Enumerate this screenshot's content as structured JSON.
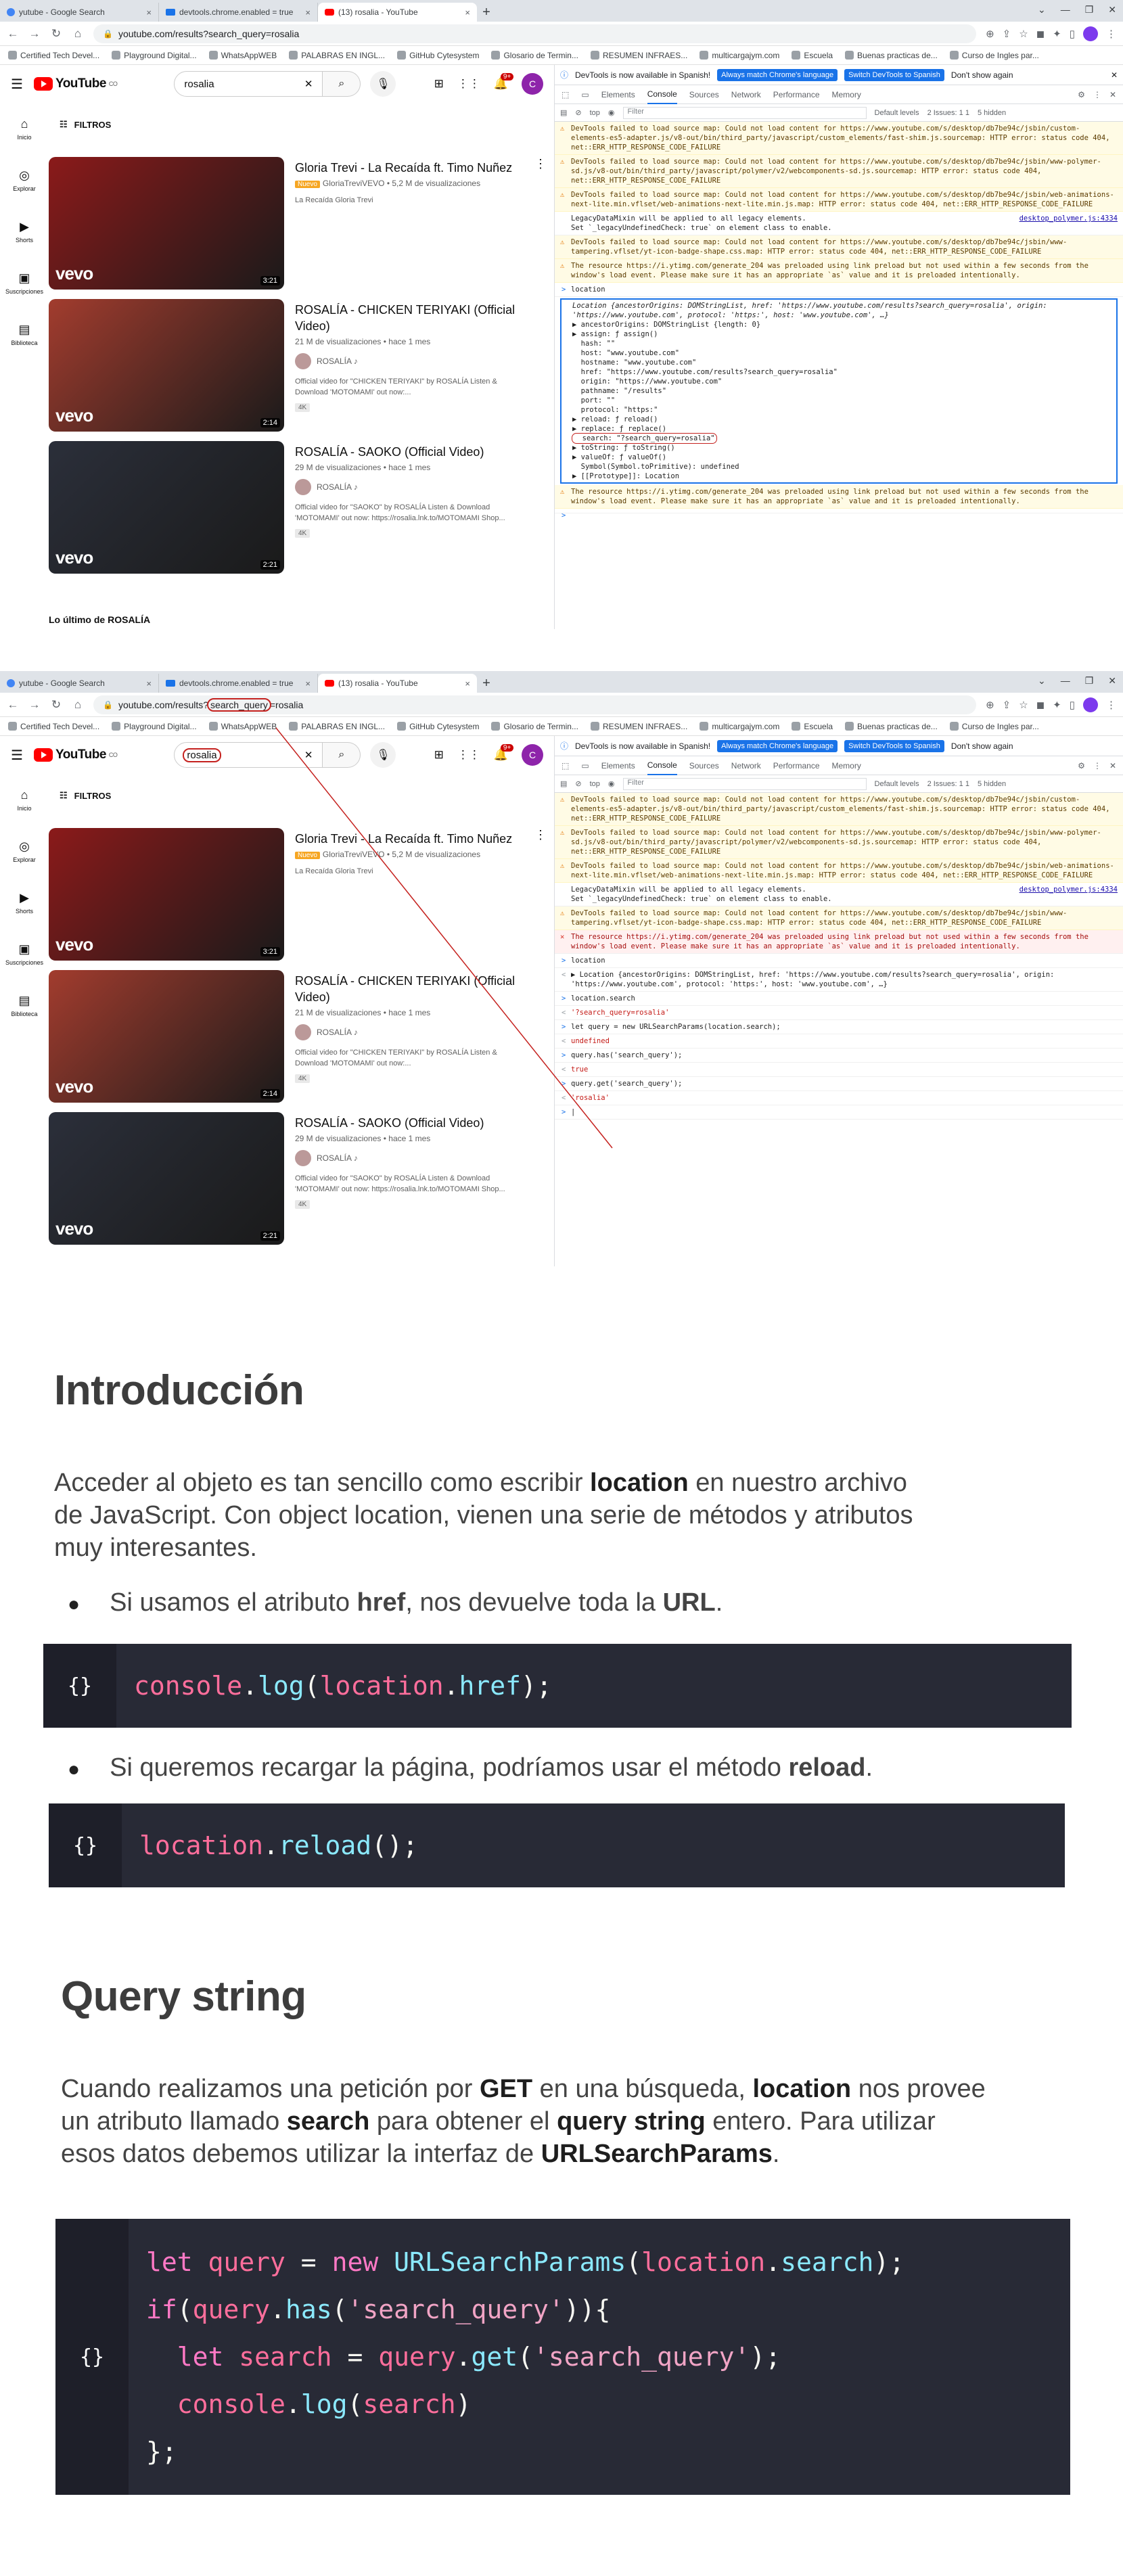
{
  "shot1": {
    "tabs": [
      {
        "label": "yutube - Google Search",
        "active": false
      },
      {
        "label": "devtools.chrome.enabled = true",
        "active": false
      },
      {
        "label": "(13) rosalia - YouTube",
        "active": true
      }
    ],
    "url_prefix": "youtube.com/results?",
    "url_query": "search_query",
    "url_suffix": "=rosalia"
  },
  "bookmarks": [
    "Certified Tech Devel...",
    "Playground Digital...",
    "WhatsAppWEB",
    "PALABRAS EN INGL...",
    "GitHub Cytesystem",
    "Glosario de Termin...",
    "RESUMEN INFRAES...",
    "multicargajym.com",
    "Escuela",
    "Buenas practicas de...",
    "Curso de Ingles par..."
  ],
  "youtube": {
    "logo_text": "YouTube",
    "logo_country": "CO",
    "search_value": "rosalia",
    "notif_count": "9+",
    "avatar_letter": "C",
    "filters_label": "FILTROS",
    "guide": [
      "Inicio",
      "Explorar",
      "Shorts",
      "Suscripciones",
      "Biblioteca"
    ],
    "videos": [
      {
        "title": "Gloria Trevi - La Recaída ft. Timo Nuñez",
        "badge": "Nuevo",
        "channel": "GloriaTreviVEVO",
        "meta": "5,2 M de visualizaciones",
        "desc": "La Recaída Gloria Trevi",
        "duration": "3:21",
        "color": "#8b1a1a"
      },
      {
        "title": "ROSALÍA - CHICKEN TERIYAKI (Official Video)",
        "meta": "21 M de visualizaciones • hace 1 mes",
        "channel": "ROSALÍA ♪",
        "desc": "Official video for \"CHICKEN TERIYAKI\" by ROSALÍA Listen & Download 'MOTOMAMI' out now:...",
        "tag": "4K",
        "duration": "2:14",
        "color": "#a23c2e"
      },
      {
        "title": "ROSALÍA - SAOKO (Official Video)",
        "meta": "29 M de visualizaciones • hace 1 mes",
        "channel": "ROSALÍA ♪",
        "desc": "Official video for \"SAOKO\" by ROSALÍA Listen & Download 'MOTOMAMI' out now: https://rosalia.lnk.to/MOTOMAMI Shop...",
        "tag": "4K",
        "duration": "2:21",
        "color": "#2b2f3a"
      }
    ],
    "last_section": "Lo último de ROSALÍA"
  },
  "devtools": {
    "infobar_text": "DevTools is now available in Spanish!",
    "btn_match": "Always match Chrome's language",
    "btn_switch": "Switch DevTools to Spanish",
    "btn_dont": "Don't show again",
    "tabs": [
      "Elements",
      "Console",
      "Sources",
      "Network",
      "Performance",
      "Memory"
    ],
    "issues": "2 Issues: 1 1",
    "hidden": "5 hidden",
    "context": "top",
    "filter_placeholder": "Filter",
    "levels": "Default levels",
    "warn1": "DevTools failed to load source map: Could not load content for https://www.youtube.com/s/desktop/db7be94c/jsbin/custom-elements-es5-adapter.js/v8-out/bin/third_party/javascript/custom_elements/fast-shim.js.sourcemap: HTTP error: status code 404, net::ERR_HTTP_RESPONSE_CODE_FAILURE",
    "warn2": "DevTools failed to load source map: Could not load content for https://www.youtube.com/s/desktop/db7be94c/jsbin/www-polymer-sd.js/v8-out/bin/third_party/javascript/polymer/v2/webcomponents-sd.js.sourcemap: HTTP error: status code 404, net::ERR_HTTP_RESPONSE_CODE_FAILURE",
    "warn3": "DevTools failed to load source map: Could not load content for https://www.youtube.com/s/desktop/db7be94c/jsbin/web-animations-next-lite.min.vflset/web-animations-next-lite.min.js.map: HTTP error: status code 404, net::ERR_HTTP_RESPONSE_CODE_FAILURE",
    "legacy": "LegacyDataMixin will be applied to all legacy elements.\nSet `_legacyUndefinedCheck: true` on element class to enable.",
    "legacy_src": "desktop_polymer.js:4334",
    "warn4": "DevTools failed to load source map: Could not load content for https://www.youtube.com/s/desktop/db7be94c/jsbin/www-tampering.vflset/yt-icon-badge-shape.css.map: HTTP error: status code 404, net::ERR_HTTP_RESPONSE_CODE_FAILURE",
    "preload": "The resource https://i.ytimg.com/generate_204 was preloaded using link preload but not used within a few seconds from the window's load event. Please make sure it has an appropriate `as` value and it is preloaded intentionally.",
    "preload_src": "results:1",
    "cmd_location": "location",
    "obj_header": "Location {ancestorOrigins: DOMStringList, href: 'https://www.youtube.com/results?search_query=rosalia', origin: 'https://www.youtube.com', protocol: 'https:', host: 'www.youtube.com', …}",
    "obj_lines": [
      "▶ ancestorOrigins: DOMStringList {length: 0}",
      "▶ assign: ƒ assign()",
      "  hash: \"\"",
      "  host: \"www.youtube.com\"",
      "  hostname: \"www.youtube.com\"",
      "  href: \"https://www.youtube.com/results?search_query=rosalia\"",
      "  origin: \"https://www.youtube.com\"",
      "  pathname: \"/results\"",
      "  port: \"\"",
      "  protocol: \"https:\"",
      "▶ reload: ƒ reload()",
      "▶ replace: ƒ replace()",
      "  search: \"?search_query=rosalia\"",
      "▶ toString: ƒ toString()",
      "▶ valueOf: ƒ valueOf()",
      "  Symbol(Symbol.toPrimitive): undefined",
      "▶ [[Prototype]]: Location"
    ],
    "cmd2": [
      {
        "k": "in",
        "t": "location"
      },
      {
        "k": "out",
        "t": "▶ Location {ancestorOrigins: DOMStringList, href: 'https://www.youtube.com/results?search_query=rosalia', origin: 'https://www.youtube.com', protocol: 'https:', host: 'www.youtube.com', …}"
      },
      {
        "k": "in",
        "t": "location.search"
      },
      {
        "k": "out",
        "t": "'?search_query=rosalia'"
      },
      {
        "k": "in",
        "t": "let query = new URLSearchParams(location.search);"
      },
      {
        "k": "out",
        "t": "undefined"
      },
      {
        "k": "in",
        "t": "query.has('search_query');"
      },
      {
        "k": "out",
        "t": "true"
      },
      {
        "k": "in",
        "t": "query.get('search_query');"
      },
      {
        "k": "out",
        "t": "'rosalia'"
      }
    ]
  },
  "slides": {
    "intro_title": "Introducción",
    "intro_p1": "Acceder al objeto es tan sencillo como escribir ",
    "intro_p1_b": "location",
    "intro_p1_rest": " en nuestro archivo",
    "intro_p2": "de JavaScript. Con object location, vienen una serie de métodos y atributos",
    "intro_p3": "muy interesantes.",
    "b1_pre": "Si usamos el atributo ",
    "b1_b1": "href",
    "b1_mid": ", nos devuelve toda la ",
    "b1_b2": "URL",
    "b1_end": ".",
    "code1": "console.log(location.href);",
    "b2_pre": "Si queremos recargar la página, podríamos usar el método ",
    "b2_b": "reload",
    "b2_end": ".",
    "code2": "location.reload();",
    "code_icon": "{}",
    "qs_title": "Query string",
    "qs_l1a": "Cuando realizamos una petición por ",
    "qs_l1b": "GET",
    "qs_l1c": " en una búsqueda, ",
    "qs_l1d": "location",
    "qs_l1e": " nos provee",
    "qs_l2a": "un atributo llamado ",
    "qs_l2b": "search",
    "qs_l2c": " para obtener el ",
    "qs_l2d": "query string",
    "qs_l2e": " entero. Para utilizar",
    "qs_l3a": "esos datos debemos utilizar la interfaz de ",
    "qs_l3b": "URLSearchParams",
    "qs_l3c": ".",
    "code3": [
      "let query = new URLSearchParams(location.search);",
      "if(query.has('search_query')){",
      "  let search = query.get('search_query');",
      "  console.log(search)",
      "};"
    ]
  }
}
